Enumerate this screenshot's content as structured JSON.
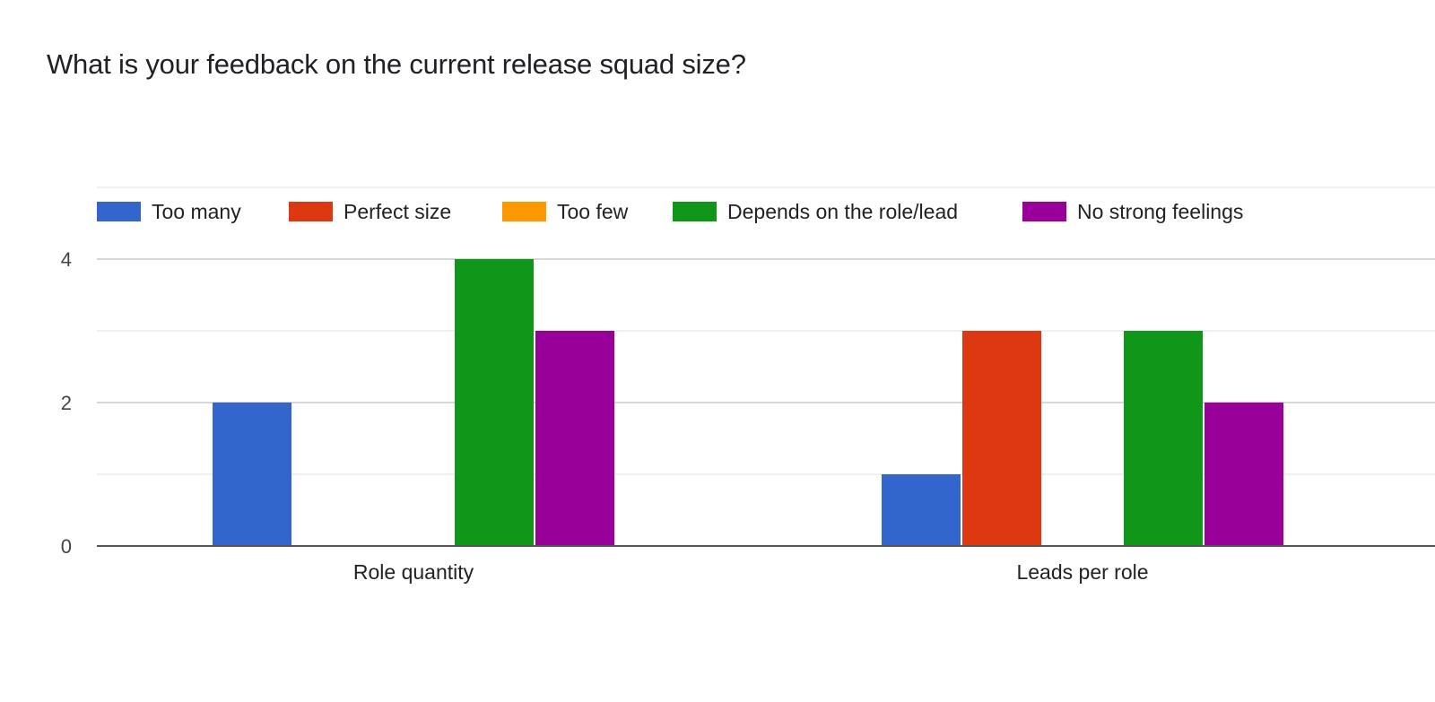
{
  "chart_data": {
    "type": "bar",
    "title": "What is your feedback on the current release squad size?",
    "categories": [
      "Role quantity",
      "Leads per role"
    ],
    "series": [
      {
        "name": "Too many",
        "color": "#3366cc",
        "values": [
          2,
          1
        ]
      },
      {
        "name": "Perfect size",
        "color": "#dc3912",
        "values": [
          0,
          3
        ]
      },
      {
        "name": "Too few",
        "color": "#ff9900",
        "values": [
          0,
          0
        ]
      },
      {
        "name": "Depends on the role/lead",
        "color": "#109618",
        "values": [
          4,
          3
        ]
      },
      {
        "name": "No strong feelings",
        "color": "#990099",
        "values": [
          3,
          2
        ]
      }
    ],
    "xlabel": "",
    "ylabel": "",
    "ylim": [
      0,
      4
    ],
    "yticks": [
      "0",
      "2",
      "4"
    ],
    "minor_gridlines": [
      1,
      3
    ],
    "grid": true,
    "legend_position": "top"
  }
}
